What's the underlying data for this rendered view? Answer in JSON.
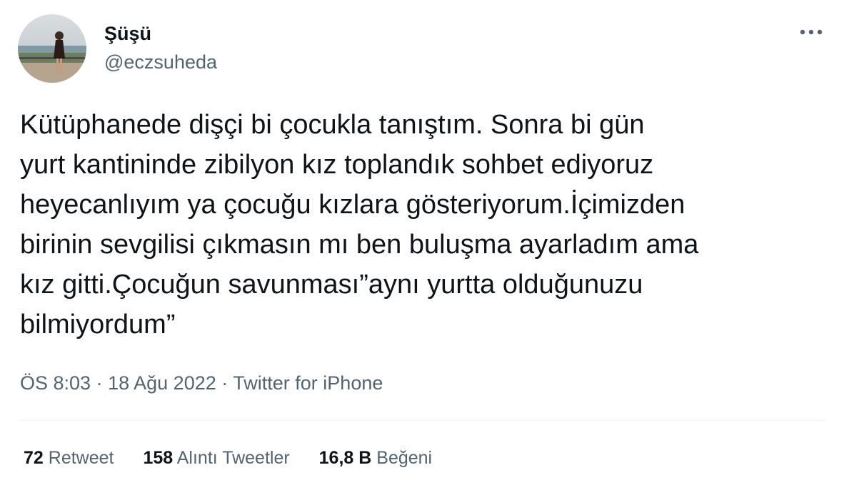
{
  "author": {
    "display_name": "Şüşü",
    "handle": "@eczsuheda"
  },
  "tweet": {
    "text": "Kütüphanede dişçi bi çocukla tanıştım. Sonra bi gün\nyurt kantininde zibilyon kız toplandık sohbet ediyoruz\nheyecanlıyım ya çocuğu kızlara gösteriyorum.İçimizden\nbirinin sevgilisi çıkmasın mı ben buluşma ayarladım ama\nkız gitti.Çocuğun savunması”aynı yurtta olduğunuzu\nbilmiyordum”",
    "time": "ÖS 8:03",
    "separator": "·",
    "date": "18 Ağu 2022",
    "source": "Twitter for iPhone"
  },
  "stats": {
    "retweets": {
      "count": "72",
      "label": "Retweet"
    },
    "quotes": {
      "count": "158",
      "label": "Alıntı Tweetler"
    },
    "likes": {
      "count": "16,8 B",
      "label": "Beğeni"
    }
  },
  "icons": {
    "more": "more-horizontal-icon"
  },
  "colors": {
    "text_primary": "#0f1419",
    "text_secondary": "#536471",
    "divider": "#eff3f4"
  }
}
